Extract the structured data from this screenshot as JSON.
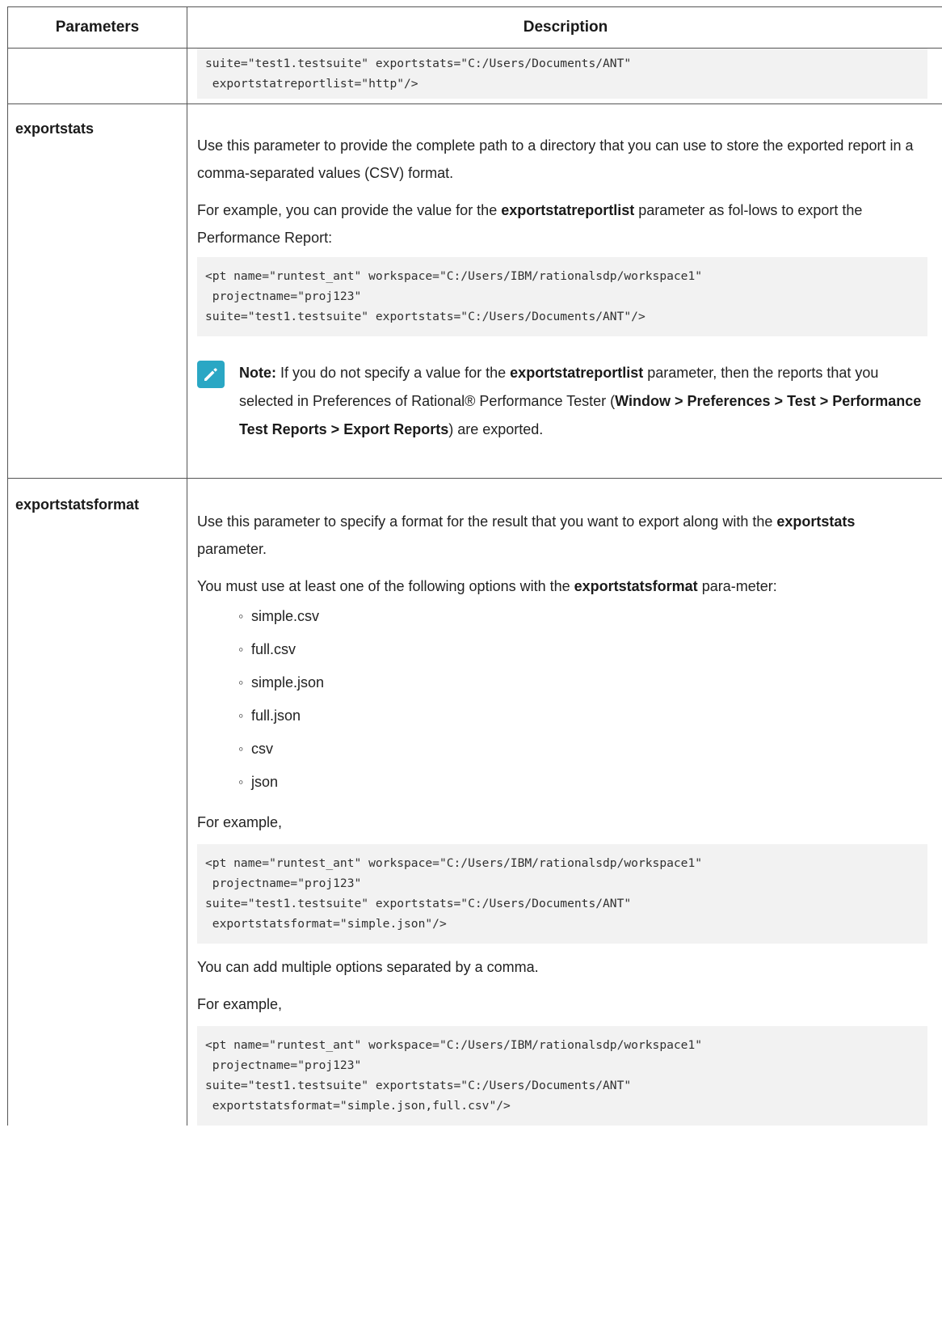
{
  "header": {
    "col1": "Parameters",
    "col2": "Description"
  },
  "row0": {
    "code": "suite=\"test1.testsuite\" exportstats=\"C:/Users/Documents/ANT\"\n exportstatreportlist=\"http\"/>"
  },
  "row1": {
    "param": "exportstats",
    "p1": "Use this parameter to provide the complete path to a directory that you can use to store the exported report in a comma-separated values (CSV) format.",
    "p2_pre": "For example, you can provide the value for the ",
    "p2_bold": "exportstatreportlist",
    "p2_post": " parameter as fol-lows to export the Performance Report:",
    "code": "<pt name=\"runtest_ant\" workspace=\"C:/Users/IBM/rationalsdp/workspace1\"\n projectname=\"proj123\"\nsuite=\"test1.testsuite\" exportstats=\"C:/Users/Documents/ANT\"/>",
    "note_label": "Note:",
    "note_pre": " If you do not specify a value for the ",
    "note_bold1": "exportstatreportlist",
    "note_mid": " parameter, then the reports that you selected in Preferences of  Rational® Performance Tester (",
    "note_bold2": "Window > Preferences > Test > Performance Test Reports > Export Reports",
    "note_post": ") are exported.",
    "note_icon": "pencil-icon"
  },
  "row2": {
    "param": "exportstatsformat",
    "p1_pre": "Use this parameter to specify a format for the result that you want to export along with the ",
    "p1_bold": "exportstats",
    "p1_post": " parameter.",
    "p2_pre": "You must use at least one of the following options with the ",
    "p2_bold": "exportstatsformat",
    "p2_post": " para-meter:",
    "options": [
      "simple.csv",
      "full.csv",
      "simple.json",
      "full.json",
      "csv",
      "json"
    ],
    "bullet": "◦",
    "p3": "For example,",
    "code1": "<pt name=\"runtest_ant\" workspace=\"C:/Users/IBM/rationalsdp/workspace1\"\n projectname=\"proj123\"\nsuite=\"test1.testsuite\" exportstats=\"C:/Users/Documents/ANT\"\n exportstatsformat=\"simple.json\"/>",
    "p4": "You can add multiple options separated by a comma.",
    "p5": "For example,",
    "code2": "<pt name=\"runtest_ant\" workspace=\"C:/Users/IBM/rationalsdp/workspace1\"\n projectname=\"proj123\"\nsuite=\"test1.testsuite\" exportstats=\"C:/Users/Documents/ANT\"\n exportstatsformat=\"simple.json,full.csv\"/>"
  }
}
